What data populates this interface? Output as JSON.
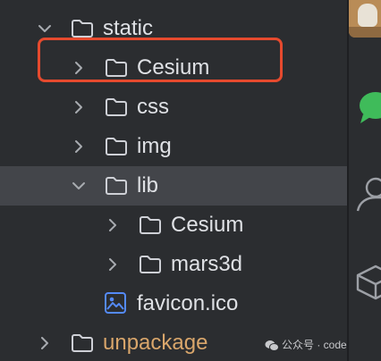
{
  "tree": {
    "rows": [
      {
        "label": "static",
        "expanded": true,
        "icon": "folder-icon"
      },
      {
        "label": "Cesium",
        "expanded": false,
        "icon": "folder-icon"
      },
      {
        "label": "css",
        "expanded": false,
        "icon": "folder-icon"
      },
      {
        "label": "img",
        "expanded": false,
        "icon": "folder-icon"
      },
      {
        "label": "lib",
        "expanded": true,
        "icon": "folder-icon",
        "selected": true
      },
      {
        "label": "Cesium",
        "expanded": false,
        "icon": "folder-icon"
      },
      {
        "label": "mars3d",
        "expanded": false,
        "icon": "folder-icon"
      },
      {
        "label": "favicon.ico",
        "icon": "image-file-icon"
      },
      {
        "label": "unpackage",
        "expanded": false,
        "icon": "folder-icon",
        "excluded": true
      }
    ]
  },
  "highlight": {
    "color": "#e64a2e",
    "target": "Cesium"
  },
  "watermark": {
    "text": "公众号 · coderco",
    "icon": "wechat-icon"
  },
  "colors": {
    "panel": "#2b2d30",
    "selected_row": "#43454a",
    "text": "#dfe1e5",
    "excluded_text": "#d9a66b",
    "image_icon": "#548af7"
  },
  "right_rail": {
    "icons": [
      "avatar-thumbnail",
      "chat-icon",
      "user-icon",
      "cube-icon"
    ]
  }
}
